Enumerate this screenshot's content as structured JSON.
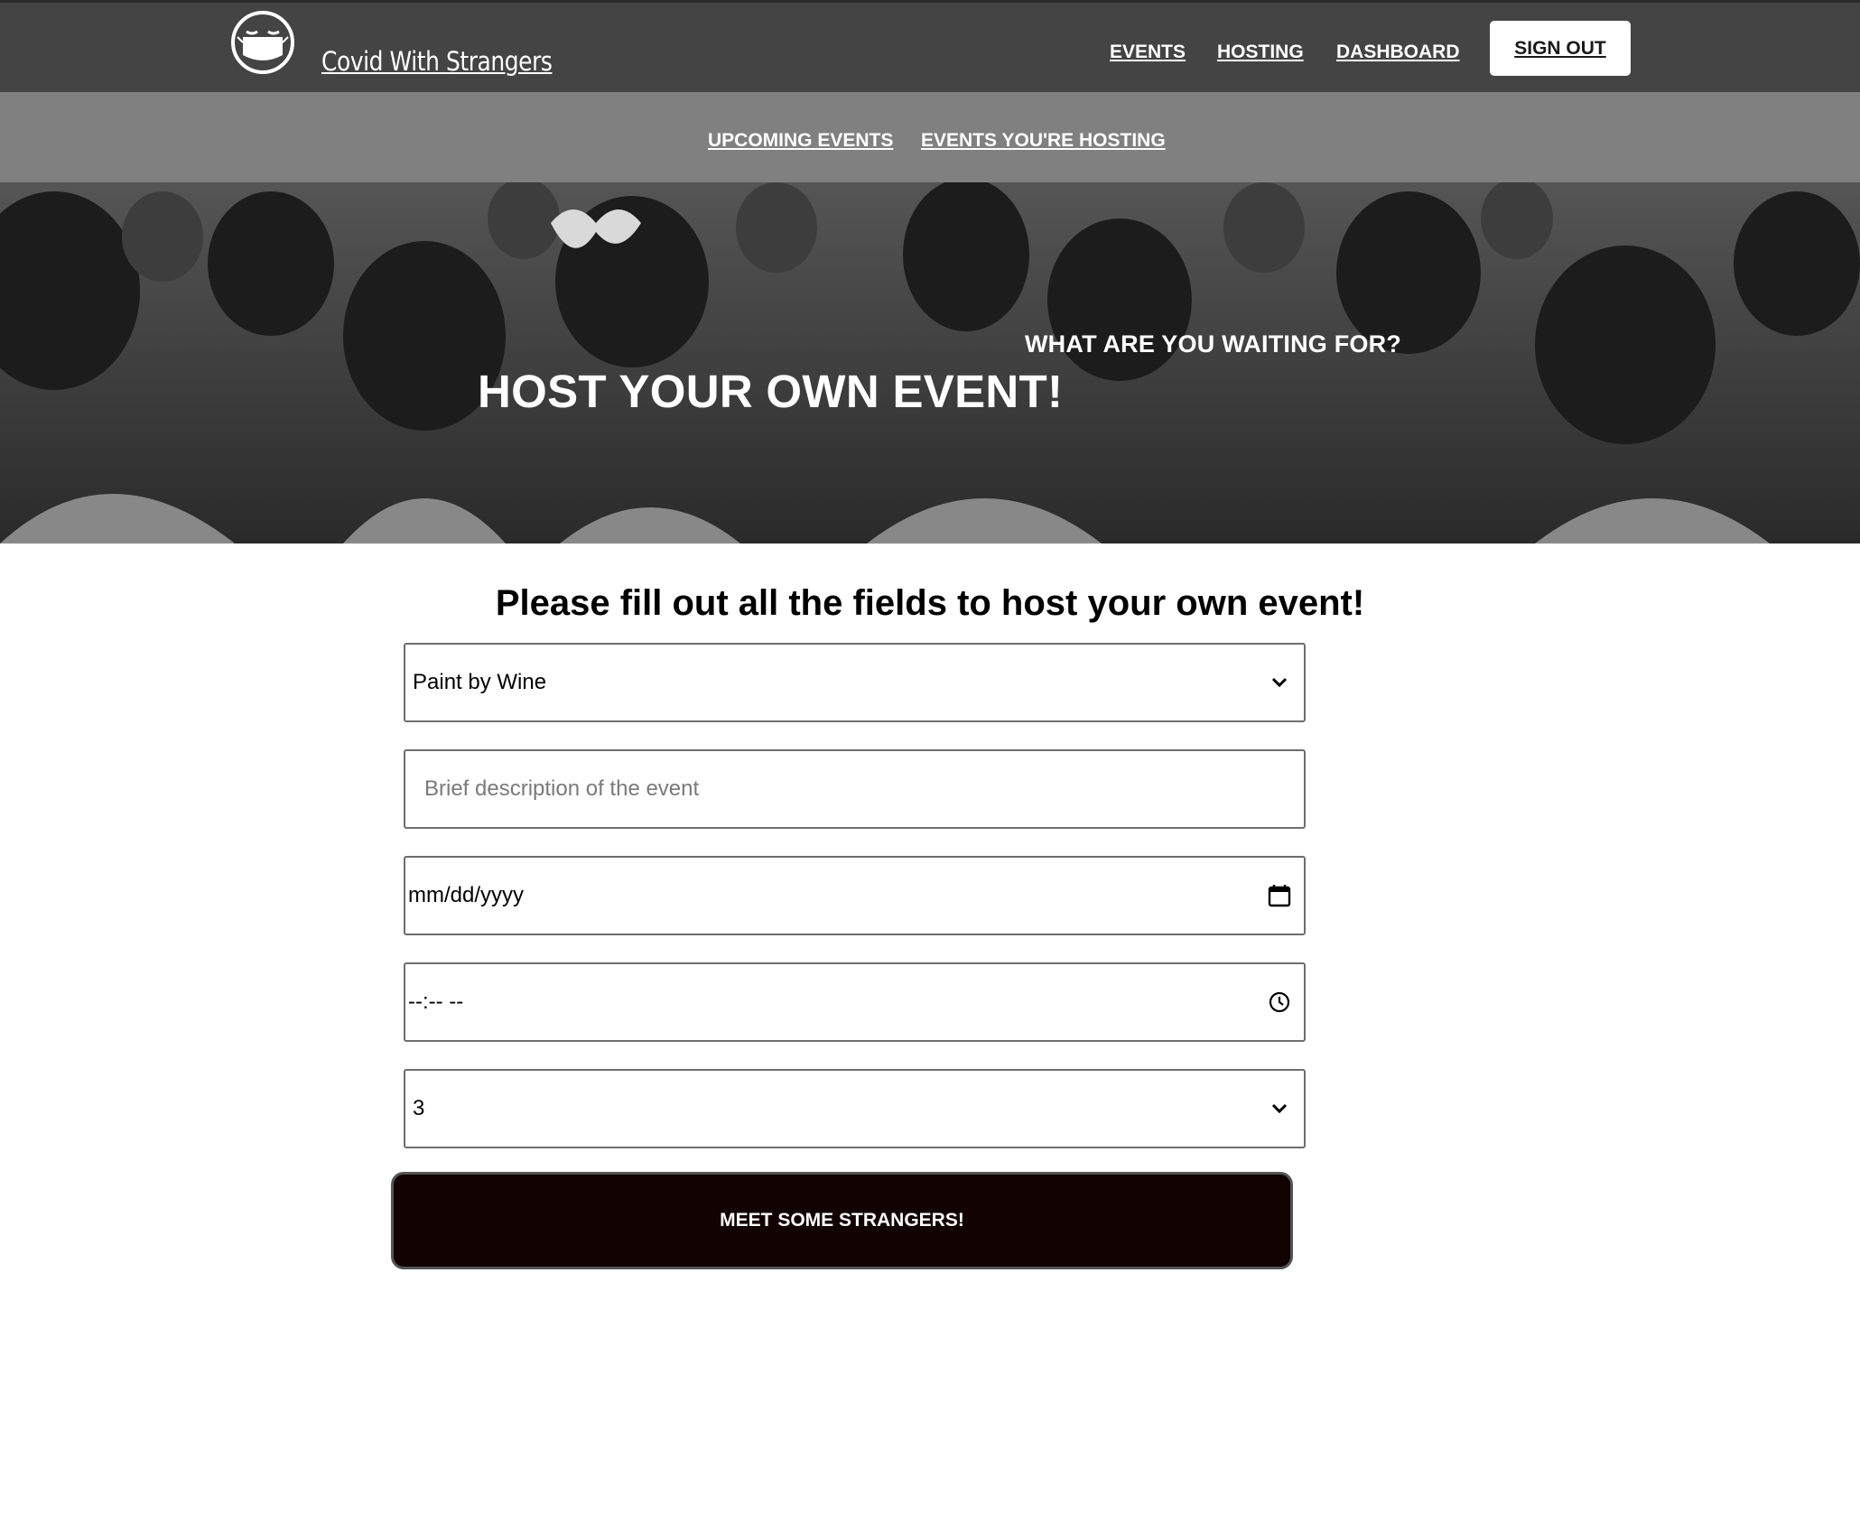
{
  "topnav": {
    "brand": "Covid With Strangers",
    "links": [
      "EVENTS",
      "HOSTING",
      "DASHBOARD"
    ],
    "signout": "SIGN OUT"
  },
  "subnav": {
    "links": [
      "UPCOMING EVENTS",
      "EVENTS YOU'RE HOSTING"
    ]
  },
  "hero": {
    "subtitle": "WHAT ARE YOU WAITING FOR?",
    "title": "HOST YOUR OWN EVENT!"
  },
  "form": {
    "heading": "Please fill out all the fields to host your own event!",
    "event_type": "Paint by Wine",
    "description_placeholder": "Brief description of the event",
    "date_placeholder": "mm/dd/yyyy",
    "time_placeholder": "--:-- --",
    "guest_count": "3",
    "submit_label": "MEET SOME STRANGERS!"
  },
  "colors": {
    "topnav_bg": "#444444",
    "subnav_bg": "#808080",
    "submit_bg": "#120202"
  }
}
